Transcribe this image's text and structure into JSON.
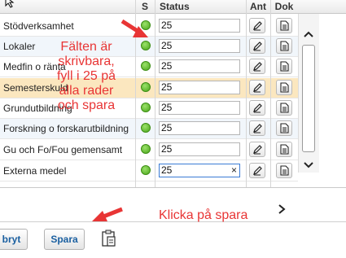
{
  "table": {
    "headers": {
      "s": "S",
      "status": "Status",
      "ant": "Ant",
      "dok": "Dok"
    },
    "rows": [
      {
        "name": "Stödverksamhet",
        "value": "25"
      },
      {
        "name": "Lokaler",
        "value": "25"
      },
      {
        "name": "Medfin o ränta",
        "value": "25"
      },
      {
        "name": "Semesterskuld",
        "value": "25"
      },
      {
        "name": "Grundutbildning",
        "value": "25"
      },
      {
        "name": "Forskning o forskarutbildning",
        "value": "25"
      },
      {
        "name": "Gu och Fo/Fou gemensamt",
        "value": "25"
      },
      {
        "name": "Externa medel",
        "value": "25",
        "clear": "×"
      }
    ]
  },
  "footer": {
    "cancel_label": "bryt",
    "save_label": "Spara"
  },
  "annotations": {
    "top": [
      "Fälten är",
      "skrivbara,",
      "fyll i 25 på",
      "alla rader",
      "och spara"
    ],
    "bottom": "Klicka på spara"
  },
  "colors": {
    "annotation": "#e83535",
    "status_ok": "#4aa51a",
    "selected_row": "#fbe7bf"
  }
}
